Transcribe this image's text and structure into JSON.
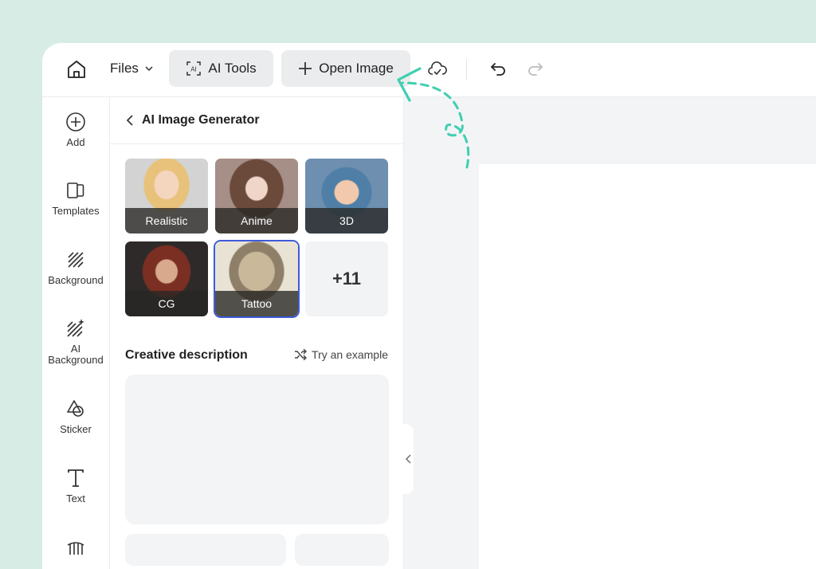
{
  "toolbar": {
    "files_label": "Files",
    "ai_tools_label": "AI Tools",
    "open_image_label": "Open Image"
  },
  "sidebar": {
    "items": [
      {
        "label": "Add",
        "icon": "plus-circle-icon"
      },
      {
        "label": "Templates",
        "icon": "templates-icon"
      },
      {
        "label": "Background",
        "icon": "hatch-icon"
      },
      {
        "label": "AI\nBackground",
        "icon": "ai-hatch-icon"
      },
      {
        "label": "Sticker",
        "icon": "shapes-icon"
      },
      {
        "label": "Text",
        "icon": "text-icon"
      }
    ]
  },
  "panel": {
    "title": "AI Image Generator",
    "styles": [
      {
        "label": "Realistic",
        "selected": false
      },
      {
        "label": "Anime",
        "selected": false
      },
      {
        "label": "3D",
        "selected": false
      },
      {
        "label": "CG",
        "selected": false
      },
      {
        "label": "Tattoo",
        "selected": true
      }
    ],
    "more_label": "+11",
    "creative_title": "Creative description",
    "try_example": "Try an example",
    "description_value": ""
  },
  "colors": {
    "page_bg": "#d6ece4",
    "accent": "#3d5bd8",
    "annotation": "#3ecfb0"
  }
}
